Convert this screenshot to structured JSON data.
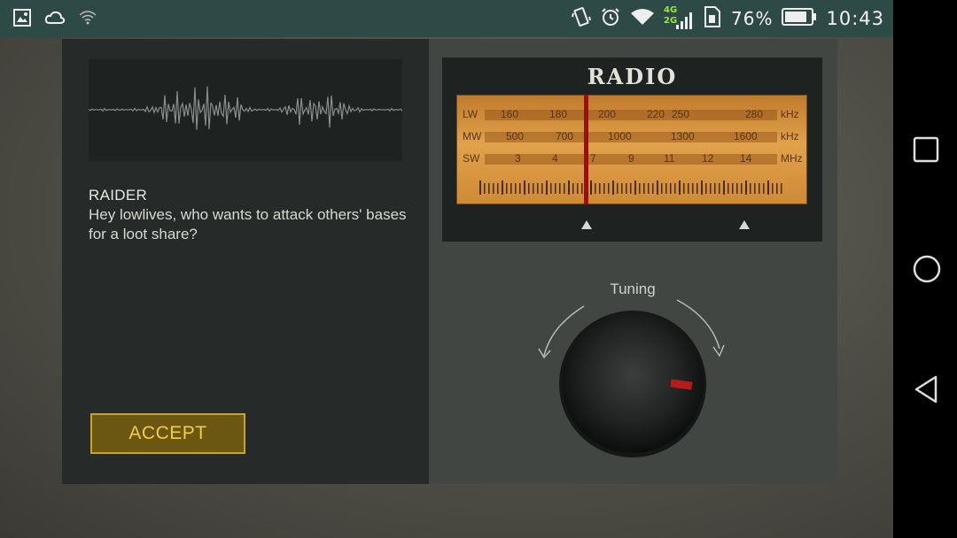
{
  "status_bar": {
    "network_top": "4G",
    "network_bottom": "2G",
    "battery_percent": "76%",
    "time": "10:43"
  },
  "chat": {
    "speaker": "RAIDER",
    "message": "Hey lowlives, who wants to attack others' bases for a loot share?",
    "accept_label": "ACCEPT"
  },
  "radio": {
    "title": "RADIO",
    "bands": [
      {
        "name": "LW",
        "values": [
          "160",
          "180",
          "200",
          "220",
          "250",
          "280"
        ],
        "unit": "kHz"
      },
      {
        "name": "MW",
        "values": [
          "500",
          "700",
          "1000",
          "1300",
          "1600"
        ],
        "unit": "kHz"
      },
      {
        "name": "SW",
        "values": [
          "3",
          "4",
          "7",
          "9",
          "11",
          "12",
          "14"
        ],
        "unit": "MHz"
      }
    ],
    "tuning_label": "Tuning"
  },
  "colors": {
    "accent": "#c9a326",
    "status_bar": "#2e4a46",
    "needle": "#9a1010"
  }
}
